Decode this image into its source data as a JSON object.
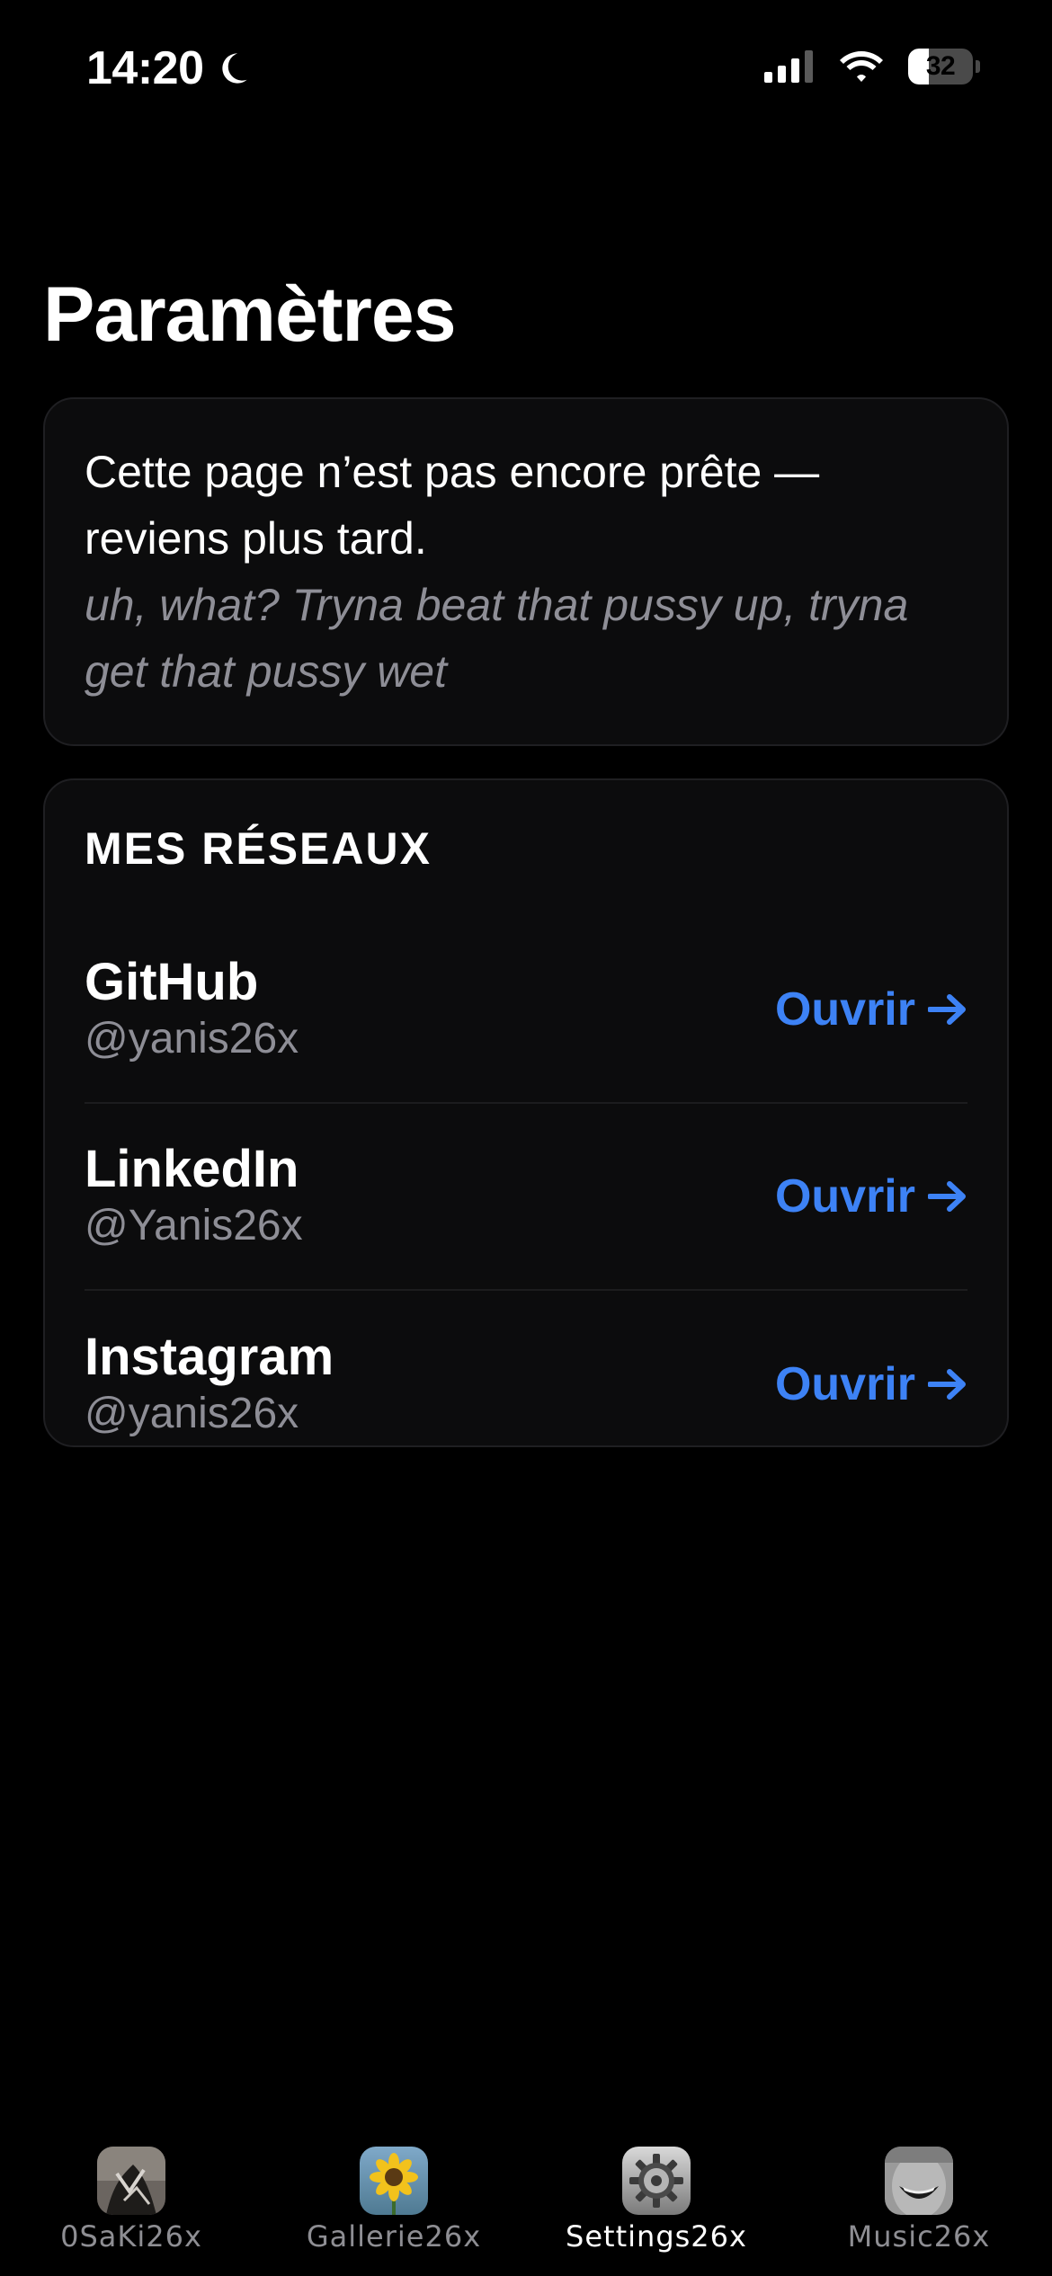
{
  "status_bar": {
    "time": "14:20",
    "battery_percent": "32",
    "battery_level": 0.32,
    "icons": [
      "moon-icon",
      "signal-icon",
      "wifi-icon",
      "battery-icon"
    ]
  },
  "page": {
    "title": "Paramètres"
  },
  "notice": {
    "message": "Cette page n’est pas encore prête — reviens plus tard.",
    "quote": "uh, what? Tryna beat that pussy up, tryna get that pussy wet"
  },
  "networks": {
    "section_title": "MES RÉSEAUX",
    "items": [
      {
        "name": "GitHub",
        "handle": "@yanis26x",
        "action": "Ouvrir"
      },
      {
        "name": "LinkedIn",
        "handle": "@Yanis26x",
        "action": "Ouvrir"
      },
      {
        "name": "Instagram",
        "handle": "@yanis26x",
        "action": "Ouvrir"
      }
    ]
  },
  "tab_bar": {
    "tabs": [
      {
        "label": "0SaKi26x",
        "icon": "osaki-avatar-icon",
        "active": false
      },
      {
        "label": "Gallerie26x",
        "icon": "sunflower-icon",
        "active": false
      },
      {
        "label": "Settings26x",
        "icon": "settings-gear-icon",
        "active": true
      },
      {
        "label": "Music26x",
        "icon": "music-face-icon",
        "active": false
      }
    ]
  },
  "colors": {
    "background": "#000000",
    "card": "#0c0c0d",
    "accent": "#3d82f5",
    "secondary_text": "#8e8e96"
  }
}
